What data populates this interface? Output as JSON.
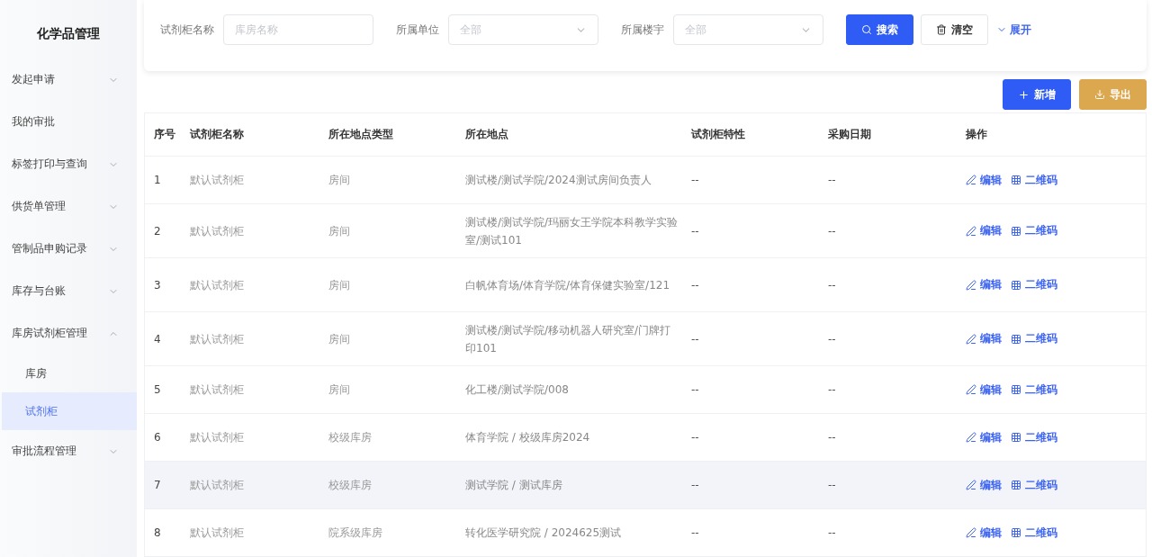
{
  "sidebar": {
    "title": "化学品管理",
    "items": [
      {
        "kind": "group",
        "label": "发起申请",
        "expanded": false
      },
      {
        "kind": "link",
        "label": "我的审批"
      },
      {
        "kind": "group",
        "label": "标签打印与查询",
        "expanded": false
      },
      {
        "kind": "group",
        "label": "供货单管理",
        "expanded": false
      },
      {
        "kind": "group",
        "label": "管制品申购记录",
        "expanded": false
      },
      {
        "kind": "group",
        "label": "库存与台账",
        "expanded": false
      },
      {
        "kind": "group",
        "label": "库房试剂柜管理",
        "expanded": true,
        "children": [
          {
            "label": "库房",
            "selected": false
          },
          {
            "label": "试剂柜",
            "selected": true
          }
        ]
      },
      {
        "kind": "group",
        "label": "审批流程管理",
        "expanded": false
      }
    ]
  },
  "filters": [
    {
      "kind": "input",
      "label": "试剂柜名称",
      "placeholder": "库房名称"
    },
    {
      "kind": "select",
      "label": "所属单位",
      "placeholder": "全部"
    },
    {
      "kind": "select",
      "label": "所属楼宇",
      "placeholder": "全部"
    }
  ],
  "filter_buttons": {
    "search": "搜索",
    "clear": "清空",
    "expand": "展开"
  },
  "actions": {
    "add": "新增",
    "export": "导出"
  },
  "table": {
    "columns": [
      "序号",
      "试剂柜名称",
      "所在地点类型",
      "所在地点",
      "试剂柜特性",
      "采购日期",
      "操作"
    ],
    "rows": [
      {
        "index": "1",
        "name": "默认试剂柜",
        "location_type": "房间",
        "location": "测试楼/测试学院/2024测试房间负责人",
        "feature": "--",
        "purchase_date": "--",
        "edit": "编辑",
        "qrcode": "二维码",
        "highlighted": false
      },
      {
        "index": "2",
        "name": "默认试剂柜",
        "location_type": "房间",
        "location": "测试楼/测试学院/玛丽女王学院本科教学实验室/测试101",
        "feature": "--",
        "purchase_date": "--",
        "edit": "编辑",
        "qrcode": "二维码",
        "highlighted": false
      },
      {
        "index": "3",
        "name": "默认试剂柜",
        "location_type": "房间",
        "location": "白帆体育场/体育学院/体育保健实验室/121",
        "feature": "--",
        "purchase_date": "--",
        "edit": "编辑",
        "qrcode": "二维码",
        "highlighted": false
      },
      {
        "index": "4",
        "name": "默认试剂柜",
        "location_type": "房间",
        "location": "测试楼/测试学院/移动机器人研究室/门牌打印101",
        "feature": "--",
        "purchase_date": "--",
        "edit": "编辑",
        "qrcode": "二维码",
        "highlighted": false
      },
      {
        "index": "5",
        "name": "默认试剂柜",
        "location_type": "房间",
        "location": "化工楼/测试学院/008",
        "feature": "--",
        "purchase_date": "--",
        "edit": "编辑",
        "qrcode": "二维码",
        "highlighted": false
      },
      {
        "index": "6",
        "name": "默认试剂柜",
        "location_type": "校级库房",
        "location": "体育学院 / 校级库房2024",
        "feature": "--",
        "purchase_date": "--",
        "edit": "编辑",
        "qrcode": "二维码",
        "highlighted": false
      },
      {
        "index": "7",
        "name": "默认试剂柜",
        "location_type": "校级库房",
        "location": "测试学院 / 测试库房",
        "feature": "--",
        "purchase_date": "--",
        "edit": "编辑",
        "qrcode": "二维码",
        "highlighted": true
      },
      {
        "index": "8",
        "name": "默认试剂柜",
        "location_type": "院系级库房",
        "location": "转化医学研究院 / 2024625测试",
        "feature": "--",
        "purchase_date": "--",
        "edit": "编辑",
        "qrcode": "二维码",
        "highlighted": false
      }
    ]
  }
}
